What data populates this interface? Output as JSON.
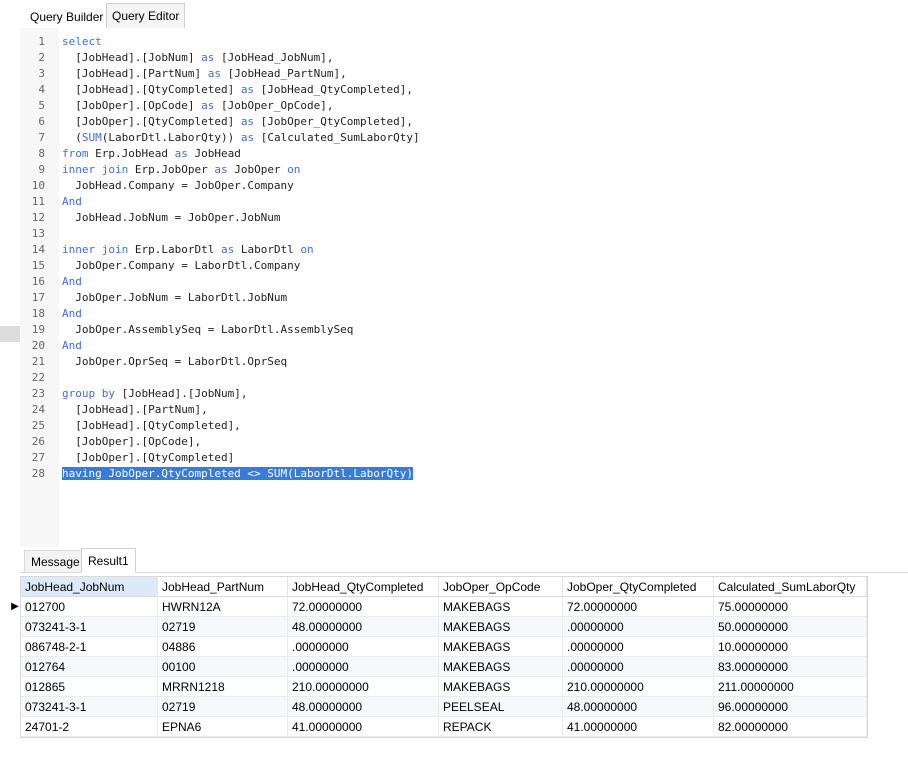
{
  "tabs": {
    "query_builder": "Query Builder",
    "query_editor": "Query Editor"
  },
  "editor": {
    "lines": [
      {
        "n": "1",
        "text": "",
        "segments": [
          {
            "t": "select",
            "k": true
          }
        ]
      },
      {
        "n": "2",
        "segments": [
          {
            "t": "  [JobHead].[JobNum] "
          },
          {
            "t": "as",
            "k": true
          },
          {
            "t": " [JobHead_JobNum],"
          }
        ]
      },
      {
        "n": "3",
        "segments": [
          {
            "t": "  [JobHead].[PartNum] "
          },
          {
            "t": "as",
            "k": true
          },
          {
            "t": " [JobHead_PartNum],"
          }
        ]
      },
      {
        "n": "4",
        "segments": [
          {
            "t": "  [JobHead].[QtyCompleted] "
          },
          {
            "t": "as",
            "k": true
          },
          {
            "t": " [JobHead_QtyCompleted],"
          }
        ]
      },
      {
        "n": "5",
        "segments": [
          {
            "t": "  [JobOper].[OpCode] "
          },
          {
            "t": "as",
            "k": true
          },
          {
            "t": " [JobOper_OpCode],"
          }
        ]
      },
      {
        "n": "6",
        "segments": [
          {
            "t": "  [JobOper].[QtyCompleted] "
          },
          {
            "t": "as",
            "k": true
          },
          {
            "t": " [JobOper_QtyCompleted],"
          }
        ]
      },
      {
        "n": "7",
        "segments": [
          {
            "t": "  ("
          },
          {
            "t": "SUM",
            "k": true
          },
          {
            "t": "(LaborDtl.LaborQty)) "
          },
          {
            "t": "as",
            "k": true
          },
          {
            "t": " [Calculated_SumLaborQty]"
          }
        ]
      },
      {
        "n": "8",
        "segments": [
          {
            "t": "from",
            "k": true
          },
          {
            "t": " Erp.JobHead "
          },
          {
            "t": "as",
            "k": true
          },
          {
            "t": " JobHead"
          }
        ]
      },
      {
        "n": "9",
        "segments": [
          {
            "t": "inner join",
            "k": true
          },
          {
            "t": " Erp.JobOper "
          },
          {
            "t": "as",
            "k": true
          },
          {
            "t": " JobOper "
          },
          {
            "t": "on",
            "k": true
          }
        ]
      },
      {
        "n": "10",
        "segments": [
          {
            "t": "  JobHead.Company = JobOper.Company"
          }
        ]
      },
      {
        "n": "11",
        "segments": [
          {
            "t": "And",
            "k": true
          }
        ]
      },
      {
        "n": "12",
        "segments": [
          {
            "t": "  JobHead.JobNum = JobOper.JobNum"
          }
        ]
      },
      {
        "n": "13",
        "segments": []
      },
      {
        "n": "14",
        "segments": [
          {
            "t": "inner join",
            "k": true
          },
          {
            "t": " Erp.LaborDtl "
          },
          {
            "t": "as",
            "k": true
          },
          {
            "t": " LaborDtl "
          },
          {
            "t": "on",
            "k": true
          }
        ]
      },
      {
        "n": "15",
        "segments": [
          {
            "t": "  JobOper.Company = LaborDtl.Company"
          }
        ]
      },
      {
        "n": "16",
        "segments": [
          {
            "t": "And",
            "k": true
          }
        ]
      },
      {
        "n": "17",
        "segments": [
          {
            "t": "  JobOper.JobNum = LaborDtl.JobNum"
          }
        ]
      },
      {
        "n": "18",
        "segments": [
          {
            "t": "And",
            "k": true
          }
        ]
      },
      {
        "n": "19",
        "segments": [
          {
            "t": "  JobOper.AssemblySeq = LaborDtl.AssemblySeq"
          }
        ]
      },
      {
        "n": "20",
        "segments": [
          {
            "t": "And",
            "k": true
          }
        ]
      },
      {
        "n": "21",
        "segments": [
          {
            "t": "  JobOper.OprSeq = LaborDtl.OprSeq"
          }
        ]
      },
      {
        "n": "22",
        "segments": []
      },
      {
        "n": "23",
        "segments": [
          {
            "t": "group by",
            "k": true
          },
          {
            "t": " [JobHead].[JobNum],"
          }
        ]
      },
      {
        "n": "24",
        "segments": [
          {
            "t": "  [JobHead].[PartNum],"
          }
        ]
      },
      {
        "n": "25",
        "segments": [
          {
            "t": "  [JobHead].[QtyCompleted],"
          }
        ]
      },
      {
        "n": "26",
        "segments": [
          {
            "t": "  [JobOper].[OpCode],"
          }
        ]
      },
      {
        "n": "27",
        "segments": [
          {
            "t": "  [JobOper].[QtyCompleted]"
          }
        ]
      },
      {
        "n": "28",
        "segments": [
          {
            "t": "having JobOper.QtyCompleted <> SUM(LaborDtl.LaborQty)",
            "h": true
          }
        ]
      }
    ]
  },
  "result_tabs": {
    "message": "Message",
    "result1": "Result1"
  },
  "grid": {
    "columns": [
      "JobHead_JobNum",
      "JobHead_PartNum",
      "JobHead_QtyCompleted",
      "JobOper_OpCode",
      "JobOper_QtyCompleted",
      "Calculated_SumLaborQty"
    ],
    "rows": [
      [
        "012700",
        "HWRN12A",
        "72.00000000",
        "MAKEBAGS",
        "72.00000000",
        "75.00000000"
      ],
      [
        "073241-3-1",
        "02719",
        "48.00000000",
        "MAKEBAGS",
        ".00000000",
        "50.00000000"
      ],
      [
        "086748-2-1",
        "04886",
        ".00000000",
        "MAKEBAGS",
        ".00000000",
        "10.00000000"
      ],
      [
        "012764",
        "00100",
        ".00000000",
        "MAKEBAGS",
        ".00000000",
        "83.00000000"
      ],
      [
        "012865",
        "MRRN1218",
        "210.00000000",
        "MAKEBAGS",
        "210.00000000",
        "211.00000000"
      ],
      [
        "073241-3-1",
        "02719",
        "48.00000000",
        "PEELSEAL",
        "48.00000000",
        "96.00000000"
      ],
      [
        "24701-2",
        "EPNA6",
        "41.00000000",
        "REPACK",
        "41.00000000",
        "82.00000000"
      ]
    ],
    "current_row_marker": "▶"
  },
  "colors": {
    "keyword": "#3f6fd9",
    "selection": "#3a7bd5",
    "header_selected": "#dce9f7"
  }
}
